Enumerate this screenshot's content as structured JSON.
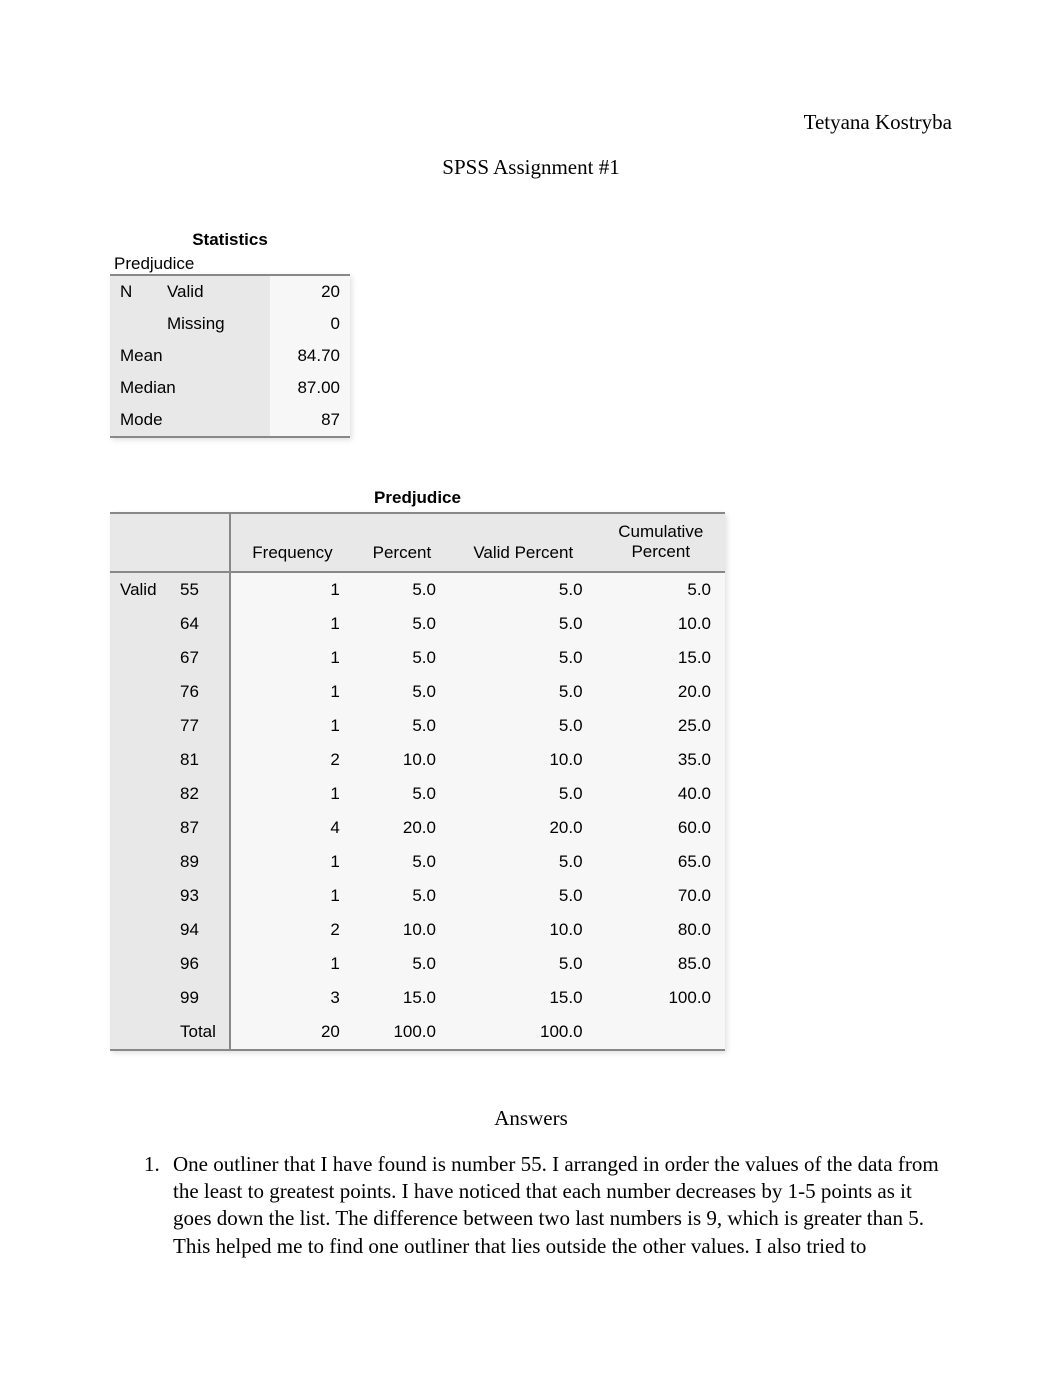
{
  "author": "Tetyana Kostryba",
  "main_title": "SPSS Assignment #1",
  "statistics": {
    "title": "Statistics",
    "subtitle": "Predjudice",
    "n_label": "N",
    "valid_label": "Valid",
    "valid_value": "20",
    "missing_label": "Missing",
    "missing_value": "0",
    "mean_label": "Mean",
    "mean_value": "84.70",
    "median_label": "Median",
    "median_value": "87.00",
    "mode_label": "Mode",
    "mode_value": "87"
  },
  "freq": {
    "title": "Predjudice",
    "headers": {
      "frequency": "Frequency",
      "percent": "Percent",
      "valid_percent": "Valid Percent",
      "cumulative_percent": "Cumulative Percent"
    },
    "valid_label": "Valid",
    "total_label": "Total",
    "rows": [
      {
        "value": "55",
        "frequency": "1",
        "percent": "5.0",
        "valid_percent": "5.0",
        "cumulative": "5.0"
      },
      {
        "value": "64",
        "frequency": "1",
        "percent": "5.0",
        "valid_percent": "5.0",
        "cumulative": "10.0"
      },
      {
        "value": "67",
        "frequency": "1",
        "percent": "5.0",
        "valid_percent": "5.0",
        "cumulative": "15.0"
      },
      {
        "value": "76",
        "frequency": "1",
        "percent": "5.0",
        "valid_percent": "5.0",
        "cumulative": "20.0"
      },
      {
        "value": "77",
        "frequency": "1",
        "percent": "5.0",
        "valid_percent": "5.0",
        "cumulative": "25.0"
      },
      {
        "value": "81",
        "frequency": "2",
        "percent": "10.0",
        "valid_percent": "10.0",
        "cumulative": "35.0"
      },
      {
        "value": "82",
        "frequency": "1",
        "percent": "5.0",
        "valid_percent": "5.0",
        "cumulative": "40.0"
      },
      {
        "value": "87",
        "frequency": "4",
        "percent": "20.0",
        "valid_percent": "20.0",
        "cumulative": "60.0"
      },
      {
        "value": "89",
        "frequency": "1",
        "percent": "5.0",
        "valid_percent": "5.0",
        "cumulative": "65.0"
      },
      {
        "value": "93",
        "frequency": "1",
        "percent": "5.0",
        "valid_percent": "5.0",
        "cumulative": "70.0"
      },
      {
        "value": "94",
        "frequency": "2",
        "percent": "10.0",
        "valid_percent": "10.0",
        "cumulative": "80.0"
      },
      {
        "value": "96",
        "frequency": "1",
        "percent": "5.0",
        "valid_percent": "5.0",
        "cumulative": "85.0"
      },
      {
        "value": "99",
        "frequency": "3",
        "percent": "15.0",
        "valid_percent": "15.0",
        "cumulative": "100.0"
      }
    ],
    "total": {
      "frequency": "20",
      "percent": "100.0",
      "valid_percent": "100.0",
      "cumulative": ""
    }
  },
  "answers": {
    "title": "Answers",
    "item1": "One outliner that I have found is number 55. I arranged in order the values of the data from the least to greatest points. I have noticed that each number decreases by 1-5 points as it goes down the list. The difference between two last numbers is 9, which is greater than 5. This helped me to find one outliner that lies outside the other values. I also tried to"
  }
}
